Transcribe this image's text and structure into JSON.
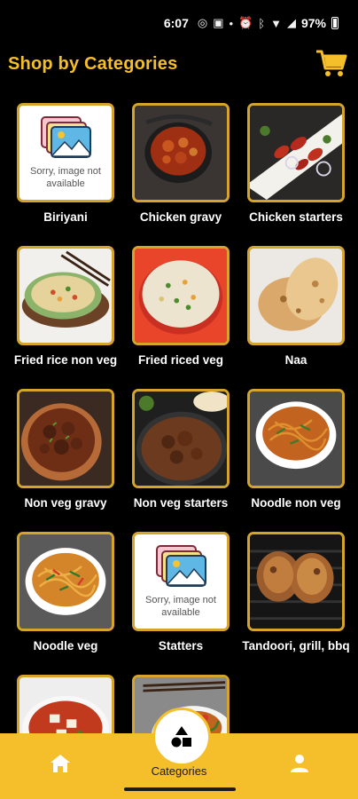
{
  "status_bar": {
    "time": "6:07",
    "battery": "97%"
  },
  "header": {
    "title": "Shop by Categories"
  },
  "placeholder_text": "Sorry, image not available",
  "categories": [
    {
      "label": "Biriyani",
      "image": "placeholder"
    },
    {
      "label": "Chicken gravy",
      "image": "chicken-gravy"
    },
    {
      "label": "Chicken starters",
      "image": "chicken-starters"
    },
    {
      "label": "Fried rice non veg",
      "image": "fried-rice-non-veg"
    },
    {
      "label": "Fried riced veg",
      "image": "fried-rice-veg"
    },
    {
      "label": "Naa",
      "image": "naan"
    },
    {
      "label": "Non veg gravy",
      "image": "non-veg-gravy"
    },
    {
      "label": "Non veg starters",
      "image": "non-veg-starters"
    },
    {
      "label": "Noodle non veg",
      "image": "noodle-non-veg"
    },
    {
      "label": "Noodle veg",
      "image": "noodle-veg"
    },
    {
      "label": "Statters",
      "image": "placeholder"
    },
    {
      "label": "Tandoori, grill, bbq",
      "image": "tandoori"
    },
    {
      "label": "",
      "image": "paneer-curry"
    },
    {
      "label": "",
      "image": "noodle-plate"
    }
  ],
  "bottom_nav": {
    "center_label": "Categories"
  },
  "colors": {
    "accent": "#f4bf2a",
    "border": "#d4a52a",
    "background": "#000000"
  }
}
